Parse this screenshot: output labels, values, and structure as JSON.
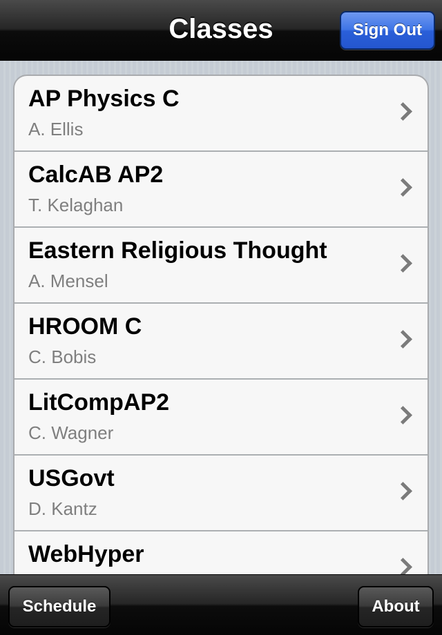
{
  "navbar": {
    "title": "Classes",
    "signout_label": "Sign Out"
  },
  "classes": [
    {
      "name": "AP Physics C",
      "teacher": "A. Ellis"
    },
    {
      "name": "CalcAB AP2",
      "teacher": "T. Kelaghan"
    },
    {
      "name": "Eastern Religious Thought",
      "teacher": "A. Mensel"
    },
    {
      "name": "HROOM C",
      "teacher": "C. Bobis"
    },
    {
      "name": "LitCompAP2",
      "teacher": "C. Wagner"
    },
    {
      "name": "USGovt",
      "teacher": "D. Kantz"
    },
    {
      "name": "WebHyper",
      "teacher": ""
    }
  ],
  "toolbar": {
    "schedule_label": "Schedule",
    "about_label": "About"
  },
  "icons": {
    "row_disclosure": "chevron-right-icon"
  },
  "colors": {
    "signout_button": "#2a5fd8",
    "bar_background": "#0c0c0c",
    "subtitle_text": "#7f7f7f"
  }
}
